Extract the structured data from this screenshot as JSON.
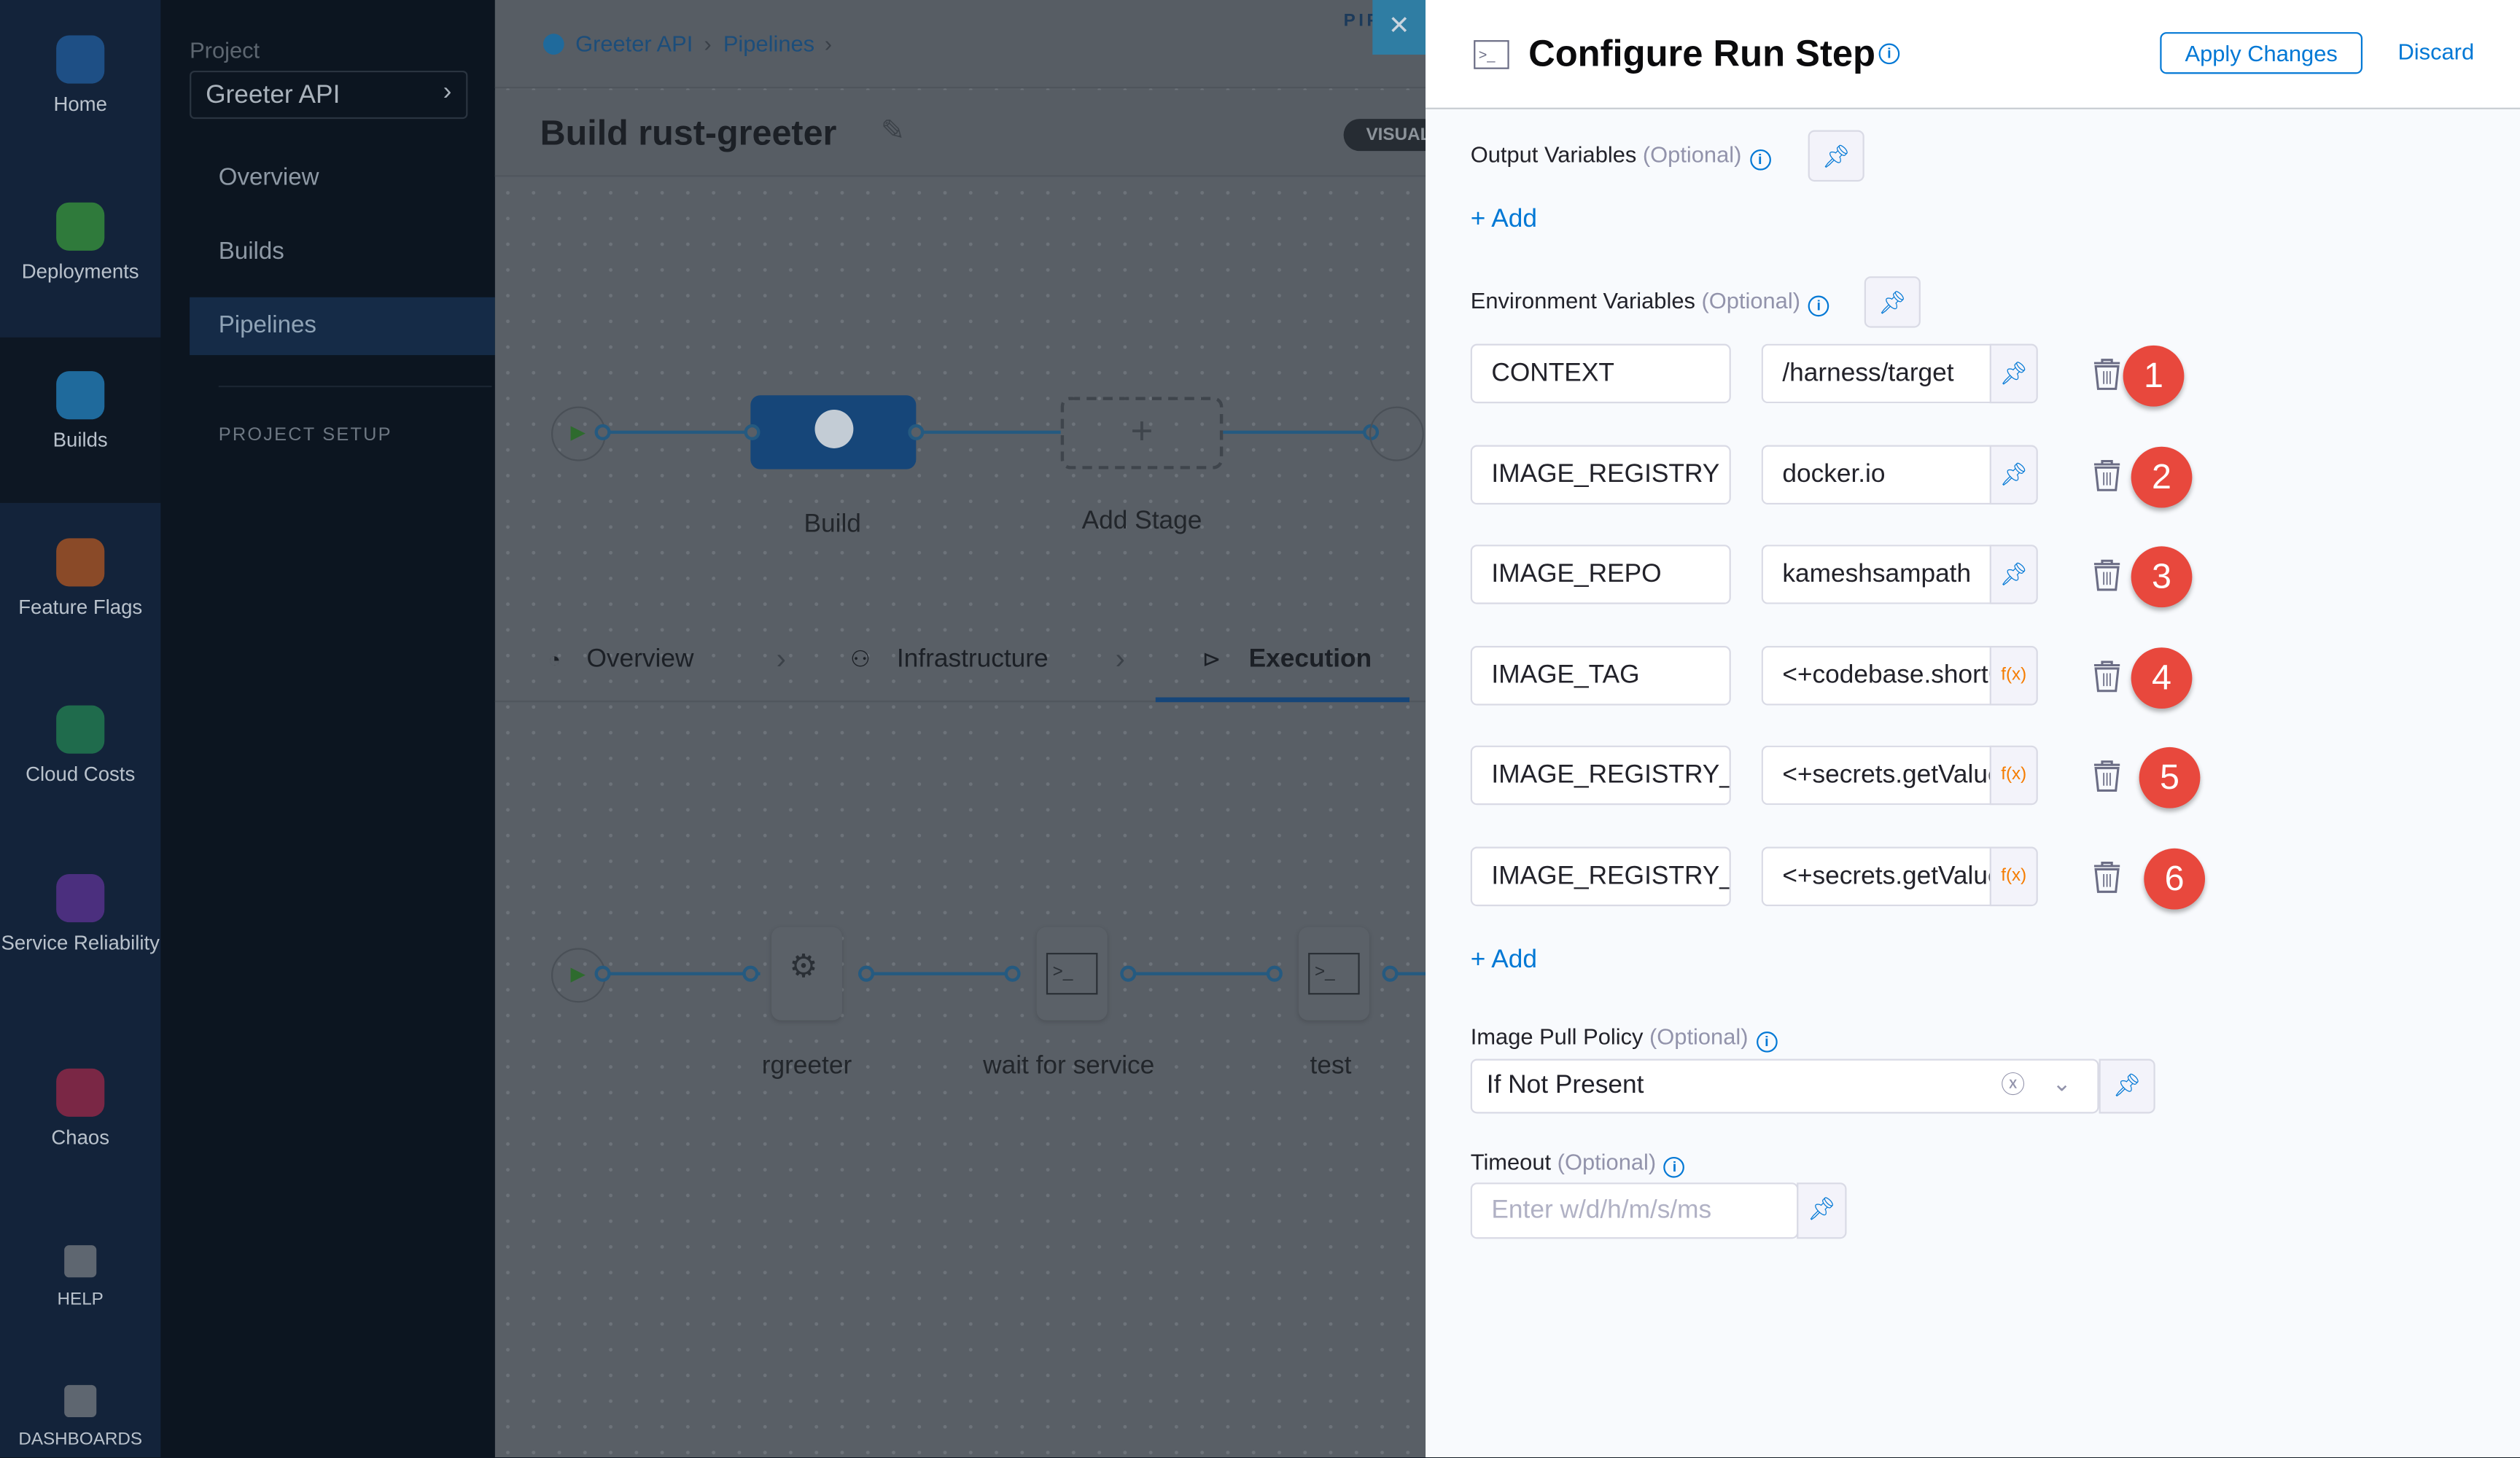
{
  "nav": {
    "items": [
      {
        "label": "Home",
        "icon": "home-icon",
        "color": "#1e4f85"
      },
      {
        "label": "Deployments",
        "icon": "deployments-icon",
        "color": "#2f7a3b"
      },
      {
        "label": "Builds",
        "icon": "builds-icon",
        "color": "#1f6a9c",
        "selected": true
      },
      {
        "label": "Feature Flags",
        "icon": "feature-flags-icon",
        "color": "#8a4a28"
      },
      {
        "label": "Cloud Costs",
        "icon": "cloud-costs-icon",
        "color": "#1f6b4c"
      },
      {
        "label": "Service Reliability",
        "icon": "service-reliability-icon",
        "color": "#4b2f7e"
      },
      {
        "label": "Chaos",
        "icon": "chaos-icon",
        "color": "#7a2745"
      },
      {
        "label": "HELP",
        "icon": "help-icon",
        "color": "#5e6670"
      },
      {
        "label": "DASHBOARDS",
        "icon": "dashboards-icon",
        "color": "#5e6670"
      }
    ]
  },
  "project": {
    "caption": "Project",
    "name": "Greeter API",
    "links": [
      "Overview",
      "Builds",
      "Pipelines"
    ],
    "active": "Pipelines",
    "setup": "PROJECT SETUP"
  },
  "breadcrumb": [
    "Greeter API",
    "Pipelines"
  ],
  "pipeline": {
    "title": "Build rust-greeter",
    "view_toggle": "VISUAL",
    "tab_overlay": "PIPELINE",
    "stages": [
      "Build",
      "Add Stage"
    ],
    "tabs": [
      "Overview",
      "Infrastructure",
      "Execution"
    ],
    "active_tab": "Execution",
    "steps": [
      "rgreeter",
      "wait for service",
      "test"
    ]
  },
  "panel": {
    "title": "Configure Run Step",
    "apply": "Apply Changes",
    "discard": "Discard",
    "output_vars": {
      "label": "Output Variables",
      "optional": "(Optional)",
      "add": "+ Add"
    },
    "env_vars": {
      "label": "Environment Variables",
      "optional": "(Optional)",
      "add": "+ Add",
      "rows": [
        {
          "key": "CONTEXT",
          "value": "/harness/target",
          "type": "fixed",
          "marker": "1"
        },
        {
          "key": "IMAGE_REGISTRY",
          "value": "docker.io",
          "type": "fixed",
          "marker": "2"
        },
        {
          "key": "IMAGE_REPO",
          "value": "kameshsampath",
          "type": "fixed",
          "marker": "3"
        },
        {
          "key": "IMAGE_TAG",
          "value": "<+codebase.shortCommitSha>",
          "type": "expression",
          "marker": "4"
        },
        {
          "key": "IMAGE_REGISTRY_",
          "value": "<+secrets.getValue>",
          "type": "expression",
          "marker": "5"
        },
        {
          "key": "IMAGE_REGISTRY_",
          "value": "<+secrets.getValue>",
          "type": "expression",
          "marker": "6"
        }
      ]
    },
    "pull_policy": {
      "label": "Image Pull Policy",
      "optional": "(Optional)",
      "value": "If Not Present"
    },
    "timeout": {
      "label": "Timeout",
      "optional": "(Optional)",
      "placeholder": "Enter w/d/h/m/s/ms"
    },
    "fx_label": "f(x)"
  },
  "colors": {
    "accent": "#0278d5",
    "marker": "#e8483d",
    "expression": "#f57c00"
  }
}
